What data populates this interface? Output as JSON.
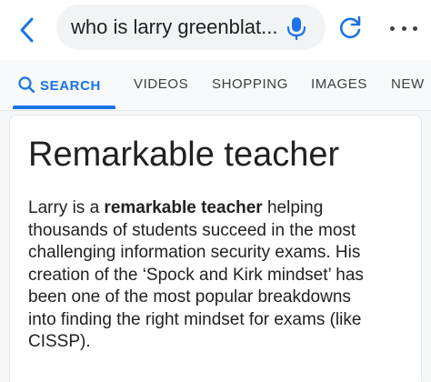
{
  "search_bar": {
    "query": "who is larry greenblat..."
  },
  "icons": {
    "back": "chevron-left-icon",
    "mic": "microphone-icon",
    "refresh": "refresh-icon",
    "more": "more-horizontal-icon"
  },
  "tabs": [
    {
      "label": "SEARCH",
      "active": true
    },
    {
      "label": "VIDEOS",
      "active": false
    },
    {
      "label": "SHOPPING",
      "active": false
    },
    {
      "label": "IMAGES",
      "active": false
    },
    {
      "label": "NEW",
      "active": false
    }
  ],
  "result": {
    "heading": "Remarkable teacher",
    "line1_before": "Larry is a ",
    "line1_bold": "remarkable teacher",
    "line1_after": " helping",
    "line2": "thousands of students succeed in the most",
    "line3": "challenging information security exams. His",
    "line4": "creation of the ‘Spock and Kirk mindset’ has",
    "line5": "been one of the most popular breakdowns",
    "line6": "into finding the right mindset for exams (like",
    "line7": "CISSP)."
  },
  "colors": {
    "accent": "#1a73e8",
    "text": "#202124",
    "pill": "#f1f3f4"
  }
}
